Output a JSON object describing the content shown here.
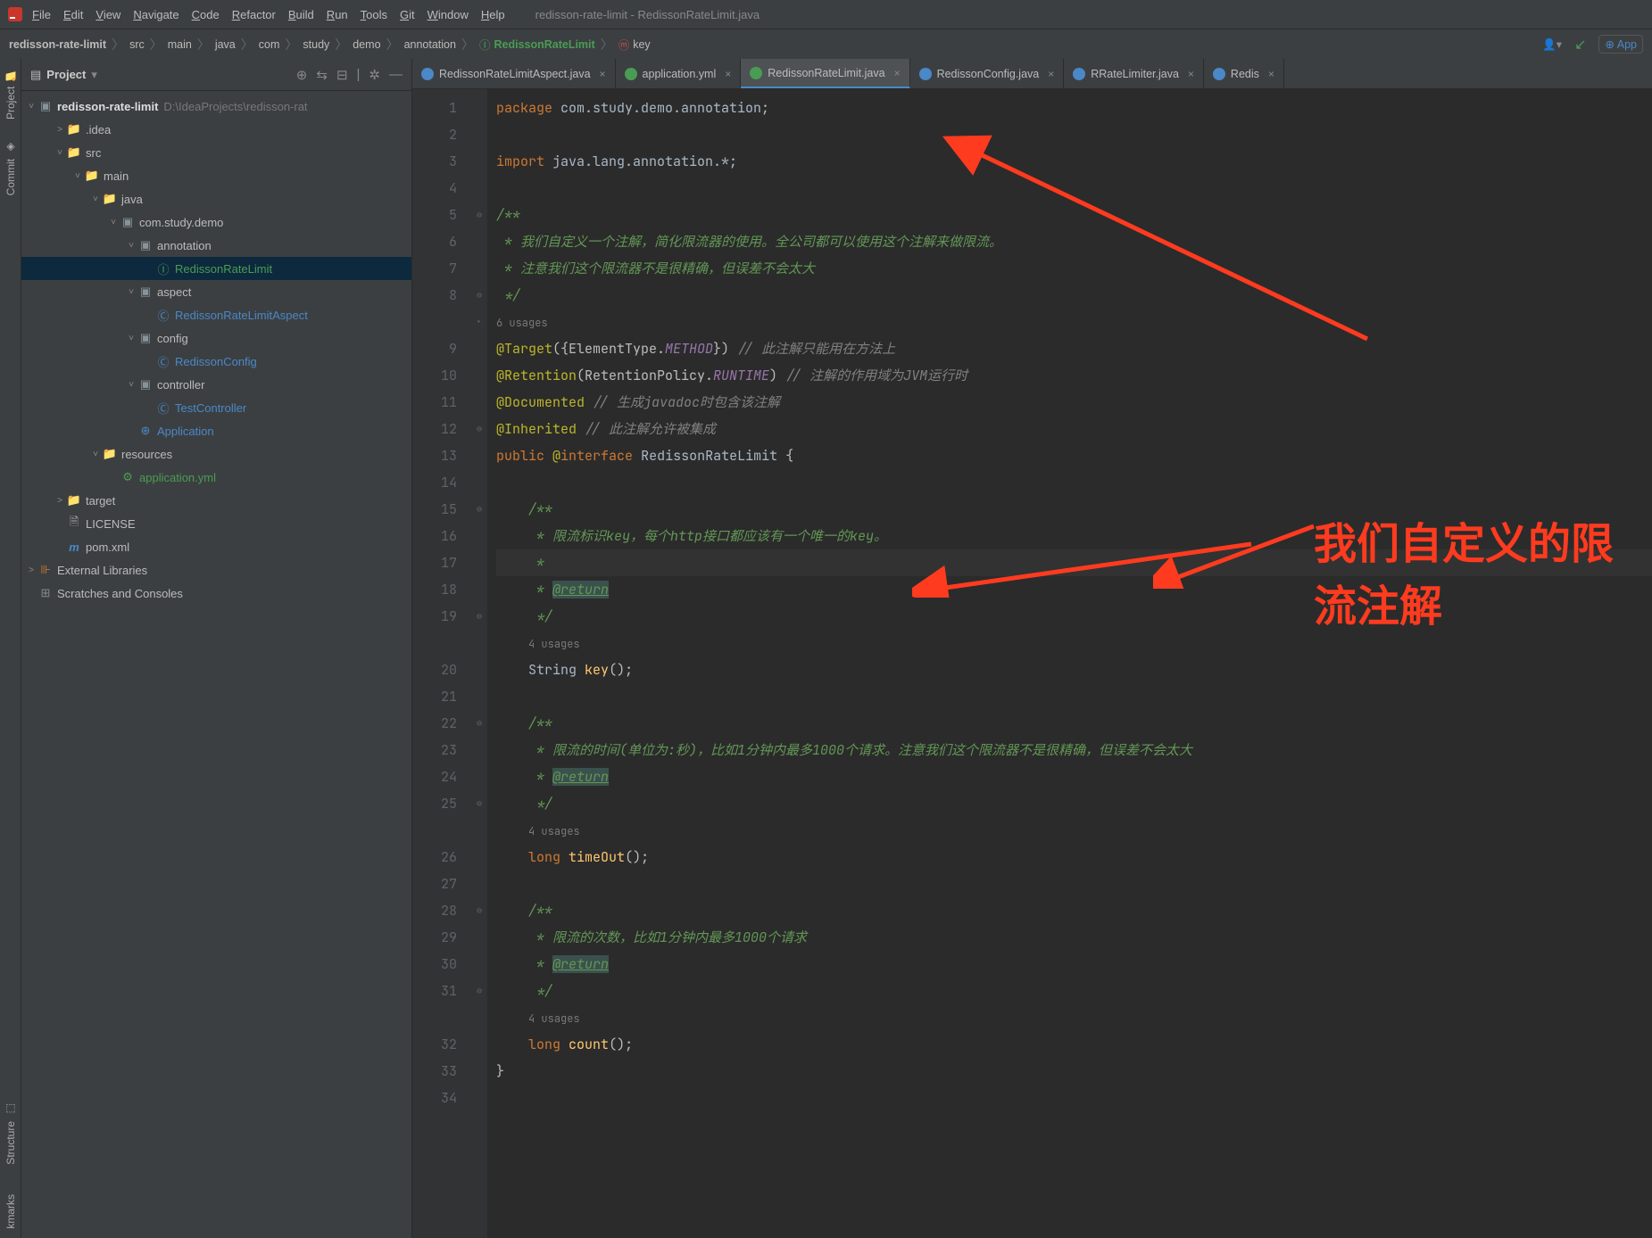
{
  "window": {
    "title": "redisson-rate-limit - RedissonRateLimit.java"
  },
  "menu": [
    "File",
    "Edit",
    "View",
    "Navigate",
    "Code",
    "Refactor",
    "Build",
    "Run",
    "Tools",
    "Git",
    "Window",
    "Help"
  ],
  "breadcrumbs": {
    "items": [
      "redisson-rate-limit",
      "src",
      "main",
      "java",
      "com",
      "study",
      "demo",
      "annotation"
    ],
    "active": "RedissonRateLimit",
    "key": "key",
    "right_app": "App"
  },
  "leftbar": {
    "project": "Project",
    "commit": "Commit",
    "structure": "Structure",
    "bookmarks": "Bookmarks"
  },
  "sidebar": {
    "header": "Project",
    "root": {
      "name": "redisson-rate-limit",
      "path": "D:\\IdeaProjects\\redisson-rat"
    },
    "rows": [
      {
        "pad": 20,
        "chev": ">",
        "ico": "📁",
        "cls": "c-folder",
        "text": ".idea"
      },
      {
        "pad": 20,
        "chev": "˅",
        "ico": "📁",
        "cls": "c-folder-alt",
        "text": "src"
      },
      {
        "pad": 40,
        "chev": "˅",
        "ico": "📁",
        "cls": "c-folder-alt",
        "text": "main"
      },
      {
        "pad": 60,
        "chev": "˅",
        "ico": "📁",
        "cls": "c-folder-alt",
        "text": "java"
      },
      {
        "pad": 80,
        "chev": "˅",
        "ico": "▣",
        "cls": "c-folder",
        "text": "com.study.demo"
      },
      {
        "pad": 100,
        "chev": "˅",
        "ico": "▣",
        "cls": "c-folder",
        "text": "annotation"
      },
      {
        "pad": 120,
        "chev": "",
        "ico": "Ⓘ",
        "cls": "c-interface",
        "text": "RedissonRateLimit",
        "sel": true
      },
      {
        "pad": 100,
        "chev": "˅",
        "ico": "▣",
        "cls": "c-folder",
        "text": "aspect"
      },
      {
        "pad": 120,
        "chev": "",
        "ico": "Ⓒ",
        "cls": "c-class",
        "text": "RedissonRateLimitAspect"
      },
      {
        "pad": 100,
        "chev": "˅",
        "ico": "▣",
        "cls": "c-folder",
        "text": "config"
      },
      {
        "pad": 120,
        "chev": "",
        "ico": "Ⓒ",
        "cls": "c-class",
        "text": "RedissonConfig"
      },
      {
        "pad": 100,
        "chev": "˅",
        "ico": "▣",
        "cls": "c-folder",
        "text": "controller"
      },
      {
        "pad": 120,
        "chev": "",
        "ico": "Ⓒ",
        "cls": "c-class",
        "text": "TestController"
      },
      {
        "pad": 100,
        "chev": "",
        "ico": "⊕",
        "cls": "c-class",
        "text": "Application"
      },
      {
        "pad": 60,
        "chev": "˅",
        "ico": "📁",
        "cls": "c-folder",
        "text": "resources"
      },
      {
        "pad": 80,
        "chev": "",
        "ico": "⚙",
        "cls": "c-interface",
        "text": "application.yml"
      },
      {
        "pad": 20,
        "chev": ">",
        "ico": "📁",
        "cls": "c-target",
        "text": "target"
      },
      {
        "pad": 20,
        "chev": "",
        "ico": "🗎",
        "cls": "c-file",
        "text": "LICENSE"
      },
      {
        "pad": 20,
        "chev": "",
        "ico": "m",
        "cls": "c-pom",
        "text": "pom.xml"
      }
    ],
    "extlib": "External Libraries",
    "scratch": "Scratches and Consoles"
  },
  "tabs": [
    {
      "icon": "#4a88c7",
      "label": "RedissonRateLimitAspect.java"
    },
    {
      "icon": "#499c54",
      "label": "application.yml"
    },
    {
      "icon": "#499c54",
      "label": "RedissonRateLimit.java",
      "active": true
    },
    {
      "icon": "#4a88c7",
      "label": "RedissonConfig.java"
    },
    {
      "icon": "#4a88c7",
      "label": "RRateLimiter.java"
    },
    {
      "icon": "#4a88c7",
      "label": "Redis"
    }
  ],
  "line_numbers": [
    "1",
    "2",
    "3",
    "4",
    "5",
    "6",
    "7",
    "8",
    "",
    "9",
    "10",
    "11",
    "12",
    "13",
    "14",
    "15",
    "16",
    "17",
    "18",
    "19",
    "",
    "20",
    "21",
    "22",
    "23",
    "24",
    "25",
    "",
    "26",
    "27",
    "28",
    "29",
    "30",
    "31",
    "",
    "32",
    "33",
    "34"
  ],
  "lines": [
    {
      "html": "<span class='kw'>package</span> <span class='cls'>com.study.demo.annotation</span>;"
    },
    {
      "html": ""
    },
    {
      "html": "<span class='kw'>import</span> <span class='cls'>java.lang.annotation.*</span>;"
    },
    {
      "html": ""
    },
    {
      "html": "<span class='doc'>/**</span>"
    },
    {
      "html": "<span class='doc'> * 我们自定义一个注解，简化限流器的使用。全公司都可以使用这个注解来做限流。</span>"
    },
    {
      "html": "<span class='doc'> * 注意我们这个限流器不是很精确，但误差不会太大</span>"
    },
    {
      "html": "<span class='doc'> */</span>"
    },
    {
      "html": "<span class='usg'>6 usages</span>"
    },
    {
      "html": "<span class='ann'>@Target</span>({ElementType.<span class='mtd'>METHOD</span>}) <span class='cm'>// 此注解只能用在方法上</span>"
    },
    {
      "html": "<span class='ann'>@Retention</span>(RetentionPolicy.<span class='mtd'>RUNTIME</span>) <span class='cm'>// 注解的作用域为JVM运行时</span>"
    },
    {
      "html": "<span class='ann'>@Documented</span> <span class='cm'>// 生成javadoc时包含该注解</span>"
    },
    {
      "html": "<span class='ann'>@Inherited</span> <span class='cm'>// 此注解允许被集成</span>"
    },
    {
      "html": "<span class='kw'>public</span> <span class='ann'>@</span><span class='kw'>interface</span> <span class='cls'>RedissonRateLimit</span> {"
    },
    {
      "html": ""
    },
    {
      "html": "    <span class='doc'>/**</span>"
    },
    {
      "html": "    <span class='doc'> * 限流标识key，每个http接口都应该有一个唯一的key。</span>"
    },
    {
      "html": "    <span class='doc'> *</span>",
      "cur": true
    },
    {
      "html": "    <span class='doc'> * </span><span class='tag'>@return</span>"
    },
    {
      "html": "    <span class='doc'> */</span>"
    },
    {
      "html": "    <span class='usg'>4 usages</span>"
    },
    {
      "html": "    <span class='cls'>String</span> <span class='id'>key</span>();"
    },
    {
      "html": ""
    },
    {
      "html": "    <span class='doc'>/**</span>"
    },
    {
      "html": "    <span class='doc'> * 限流的时间(单位为:秒)，比如1分钟内最多1000个请求。注意我们这个限流器不是很精确，但误差不会太大</span>"
    },
    {
      "html": "    <span class='doc'> * </span><span class='tag'>@return</span>"
    },
    {
      "html": "    <span class='doc'> */</span>"
    },
    {
      "html": "    <span class='usg'>4 usages</span>"
    },
    {
      "html": "    <span class='kw'>long</span> <span class='id'>timeOut</span>();"
    },
    {
      "html": ""
    },
    {
      "html": "    <span class='doc'>/**</span>"
    },
    {
      "html": "    <span class='doc'> * 限流的次数，比如1分钟内最多1000个请求</span>"
    },
    {
      "html": "    <span class='doc'> * </span><span class='tag'>@return</span>"
    },
    {
      "html": "    <span class='doc'> */</span>"
    },
    {
      "html": "    <span class='usg'>4 usages</span>"
    },
    {
      "html": "    <span class='kw'>long</span> <span class='id'>count</span>();"
    },
    {
      "html": "}"
    },
    {
      "html": ""
    }
  ],
  "annotation": "我们自定义的限流注解"
}
